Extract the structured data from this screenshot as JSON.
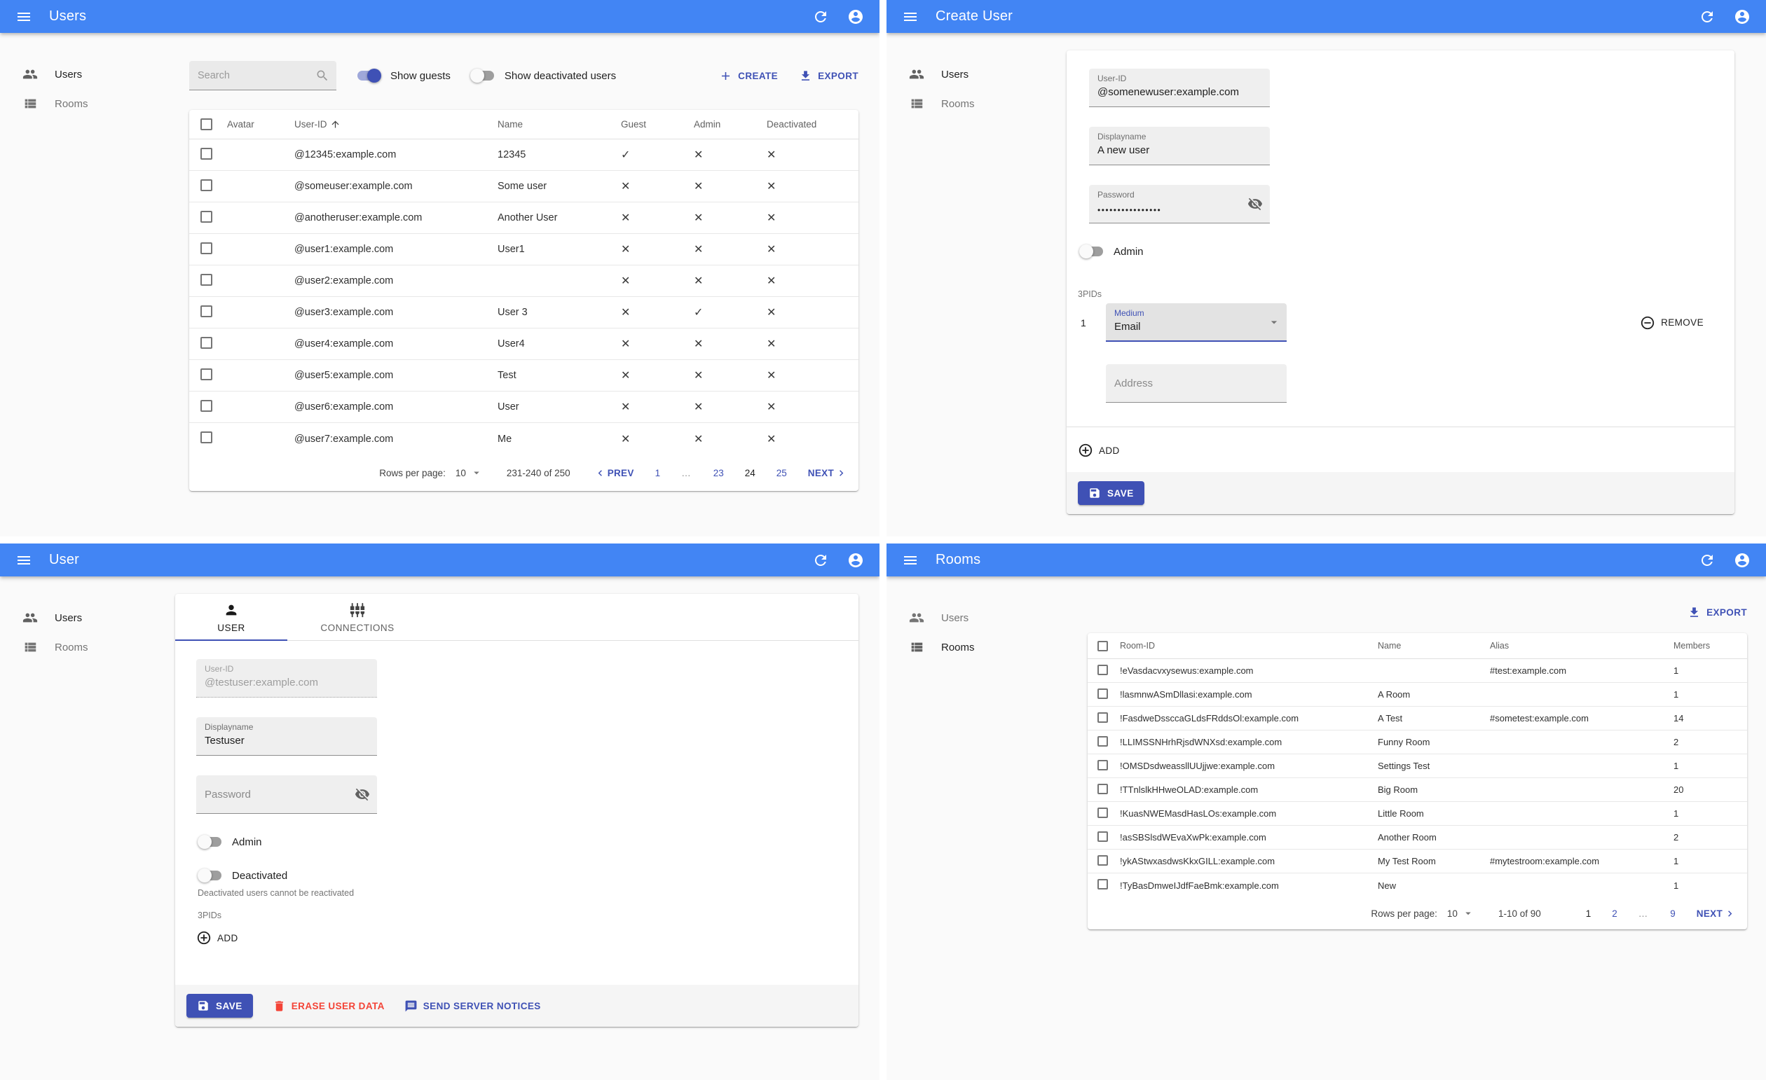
{
  "shared": {
    "sidebar_users": "Users",
    "sidebar_rooms": "Rooms",
    "rows_per_page_label": "Rows per page:",
    "rows_per_page_value": "10"
  },
  "users_panel": {
    "title": "Users",
    "search_placeholder": "Search",
    "show_guests_label": "Show guests",
    "show_guests_checked": true,
    "show_deactivated_label": "Show deactivated users",
    "show_deactivated_checked": false,
    "create_label": "CREATE",
    "export_label": "EXPORT",
    "table": {
      "headers": {
        "avatar": "Avatar",
        "user_id": "User-ID",
        "name": "Name",
        "guest": "Guest",
        "admin": "Admin",
        "deactivated": "Deactivated"
      },
      "rows": [
        {
          "user_id": "@12345:example.com",
          "name": "12345",
          "guest": true,
          "admin": false,
          "deactivated": false
        },
        {
          "user_id": "@someuser:example.com",
          "name": "Some user",
          "guest": false,
          "admin": false,
          "deactivated": false
        },
        {
          "user_id": "@anotheruser:example.com",
          "name": "Another User",
          "guest": false,
          "admin": false,
          "deactivated": false
        },
        {
          "user_id": "@user1:example.com",
          "name": "User1",
          "guest": false,
          "admin": false,
          "deactivated": false
        },
        {
          "user_id": "@user2:example.com",
          "name": "",
          "guest": false,
          "admin": false,
          "deactivated": false
        },
        {
          "user_id": "@user3:example.com",
          "name": "User 3",
          "guest": false,
          "admin": true,
          "deactivated": false
        },
        {
          "user_id": "@user4:example.com",
          "name": "User4",
          "guest": false,
          "admin": false,
          "deactivated": false
        },
        {
          "user_id": "@user5:example.com",
          "name": "Test",
          "guest": false,
          "admin": false,
          "deactivated": false
        },
        {
          "user_id": "@user6:example.com",
          "name": "User",
          "guest": false,
          "admin": false,
          "deactivated": false
        },
        {
          "user_id": "@user7:example.com",
          "name": "Me",
          "guest": false,
          "admin": false,
          "deactivated": false
        }
      ]
    },
    "pagination": {
      "range": "231-240 of 250",
      "prev_label": "PREV",
      "next_label": "NEXT",
      "pages": [
        {
          "label": "1",
          "state": "link"
        },
        {
          "label": "...",
          "state": "gap"
        },
        {
          "label": "23",
          "state": "link"
        },
        {
          "label": "24",
          "state": "current"
        },
        {
          "label": "25",
          "state": "link"
        }
      ]
    }
  },
  "create_panel": {
    "title": "Create User",
    "user_id_label": "User-ID",
    "user_id_value": "@somenewuser:example.com",
    "displayname_label": "Displayname",
    "displayname_value": "A new user",
    "password_label": "Password",
    "password_value": "••••••••••••••••",
    "admin_label": "Admin",
    "admin_checked": false,
    "threepids_label": "3PIDs",
    "threepid_index": "1",
    "medium_label": "Medium",
    "medium_value": "Email",
    "remove_label": "REMOVE",
    "address_placeholder": "Address",
    "add_label": "ADD",
    "save_label": "SAVE"
  },
  "user_panel": {
    "title": "User",
    "tab_user": "USER",
    "tab_connections": "CONNECTIONS",
    "user_id_label": "User-ID",
    "user_id_value": "@testuser:example.com",
    "displayname_label": "Displayname",
    "displayname_value": "Testuser",
    "password_placeholder": "Password",
    "admin_label": "Admin",
    "admin_checked": false,
    "deactivated_label": "Deactivated",
    "deactivated_checked": false,
    "deactivated_help": "Deactivated users cannot be reactivated",
    "threepids_label": "3PIDs",
    "add_label": "ADD",
    "save_label": "SAVE",
    "erase_label": "ERASE USER DATA",
    "notices_label": "SEND SERVER NOTICES"
  },
  "rooms_panel": {
    "title": "Rooms",
    "export_label": "EXPORT",
    "table": {
      "headers": {
        "room_id": "Room-ID",
        "name": "Name",
        "alias": "Alias",
        "members": "Members"
      },
      "rows": [
        {
          "room_id": "!eVasdacvxysewus:example.com",
          "name": "",
          "alias": "#test:example.com",
          "members": "1"
        },
        {
          "room_id": "!lasmnwASmDllasi:example.com",
          "name": "A Room",
          "alias": "",
          "members": "1"
        },
        {
          "room_id": "!FasdweDssccaGLdsFRddsOl:example.com",
          "name": "A Test",
          "alias": "#sometest:example.com",
          "members": "14"
        },
        {
          "room_id": "!LLIMSSNHrhRjsdWNXsd:example.com",
          "name": "Funny Room",
          "alias": "",
          "members": "2"
        },
        {
          "room_id": "!OMSDsdweassllUUjjwe:example.com",
          "name": "Settings Test",
          "alias": "",
          "members": "1"
        },
        {
          "room_id": "!TTnlslkHHweOLAD:example.com",
          "name": "Big Room",
          "alias": "",
          "members": "20"
        },
        {
          "room_id": "!KuasNWEMasdHasLOs:example.com",
          "name": "Little Room",
          "alias": "",
          "members": "1"
        },
        {
          "room_id": "!asSBSlsdWEvaXwPk:example.com",
          "name": "Another Room",
          "alias": "",
          "members": "2"
        },
        {
          "room_id": "!ykAStwxasdwsKkxGILL:example.com",
          "name": "My Test Room",
          "alias": "#mytestroom:example.com",
          "members": "1"
        },
        {
          "room_id": "!TyBasDmweIJdfFaeBmk:example.com",
          "name": "New",
          "alias": "",
          "members": "1"
        }
      ]
    },
    "pagination": {
      "range": "1-10 of 90",
      "next_label": "NEXT",
      "pages": [
        {
          "label": "1",
          "state": "current"
        },
        {
          "label": "2",
          "state": "link"
        },
        {
          "label": "...",
          "state": "gap"
        },
        {
          "label": "9",
          "state": "link"
        }
      ]
    }
  }
}
